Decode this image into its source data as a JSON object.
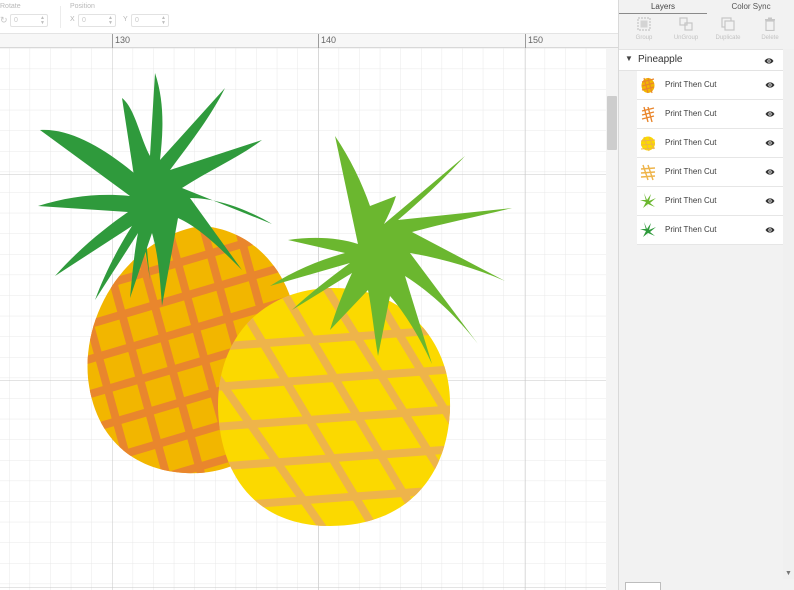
{
  "toolbar": {
    "rotate_label": "Rotate",
    "rotate_value": "0",
    "position_label": "Position",
    "x_label": "X",
    "x_value": "0",
    "y_label": "Y",
    "y_value": "0"
  },
  "ruler": {
    "ticks": [
      "130",
      "140",
      "150"
    ]
  },
  "panel": {
    "tabs": [
      "Layers",
      "Color Sync"
    ],
    "active_tab": "Layers",
    "actions": [
      {
        "label": "Group",
        "icon": "group-icon"
      },
      {
        "label": "UnGroup",
        "icon": "ungroup-icon"
      },
      {
        "label": "Duplicate",
        "icon": "duplicate-icon"
      },
      {
        "label": "Delete",
        "icon": "delete-icon"
      }
    ],
    "group_name": "Pineapple",
    "layers": [
      {
        "label": "Print Then Cut",
        "thumb": "pineapple-body-orange",
        "color": "#f2b600"
      },
      {
        "label": "Print Then Cut",
        "thumb": "pineapple-lattice-orange",
        "color": "#e9862d"
      },
      {
        "label": "Print Then Cut",
        "thumb": "pineapple-body-yellow",
        "color": "#fbd900"
      },
      {
        "label": "Print Then Cut",
        "thumb": "pineapple-lattice-yellow",
        "color": "#eeb44a"
      },
      {
        "label": "Print Then Cut",
        "thumb": "leaves-light-green",
        "color": "#6bb72f"
      },
      {
        "label": "Print Then Cut",
        "thumb": "leaves-dark-green",
        "color": "#2f9a3c"
      }
    ]
  },
  "colors": {
    "grid_minor": "#e8e8e8",
    "grid_major": "#c7c7c7",
    "dark_leaves": "#2f9a3c",
    "light_leaves": "#6bb72f",
    "body_orange": "#f2b600",
    "lattice_orange": "#e9862d",
    "body_yellow": "#fbd900",
    "lattice_yellow": "#eeb44a"
  }
}
